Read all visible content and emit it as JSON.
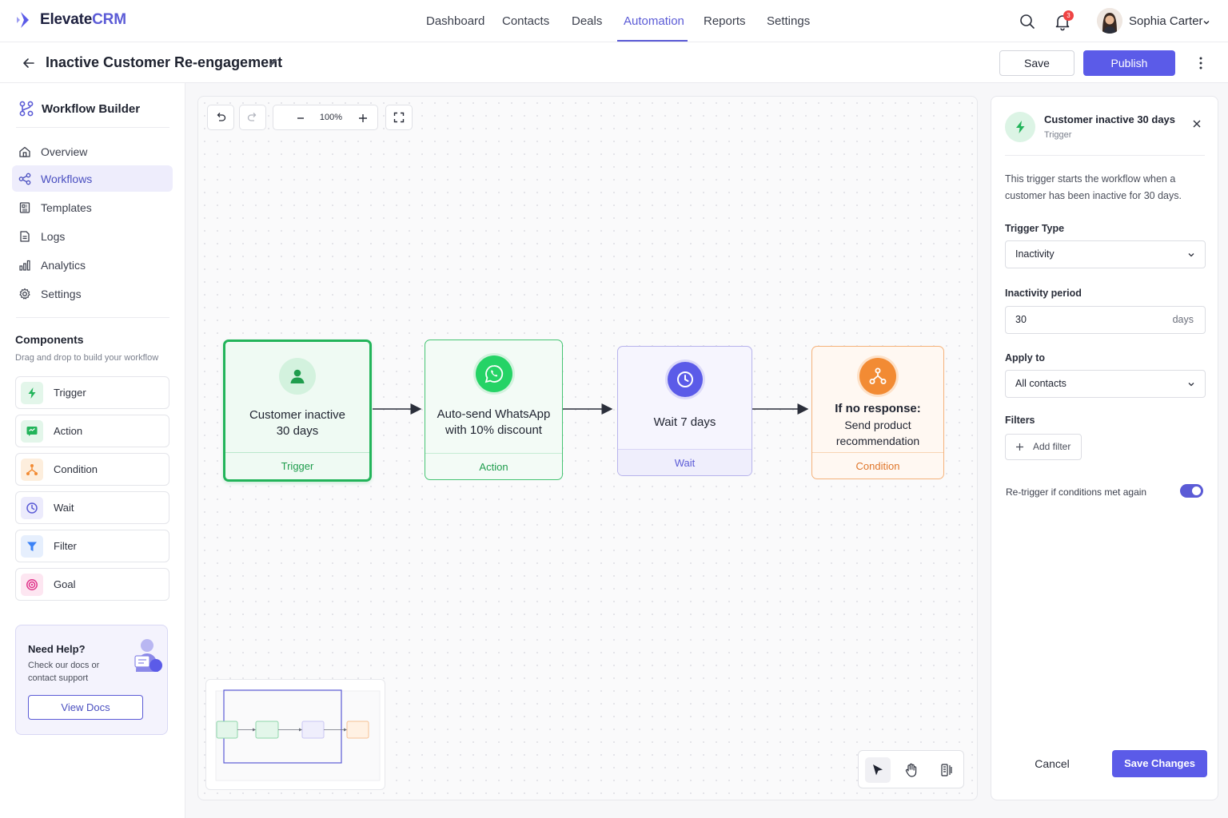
{
  "app": {
    "brand_main": "Elevate",
    "brand_accent": "CRM",
    "accent_color": "#5b5be8"
  },
  "nav": {
    "items": [
      {
        "label": "Dashboard",
        "active": false
      },
      {
        "label": "Contacts",
        "active": false
      },
      {
        "label": "Deals",
        "active": false
      },
      {
        "label": "Automation",
        "active": true
      },
      {
        "label": "Reports",
        "active": false
      },
      {
        "label": "Settings",
        "active": false
      }
    ],
    "notification_count": "3",
    "user_name": "Sophia Carter"
  },
  "header": {
    "title": "Inactive Customer Re-engagement",
    "save_label": "Save",
    "publish_label": "Publish"
  },
  "sidebar": {
    "title": "Workflow Builder",
    "items": [
      {
        "label": "Overview",
        "icon": "home-icon"
      },
      {
        "label": "Workflows",
        "icon": "workflow-icon",
        "active": true
      },
      {
        "label": "Templates",
        "icon": "template-icon"
      },
      {
        "label": "Logs",
        "icon": "log-icon"
      },
      {
        "label": "Analytics",
        "icon": "bar-chart-icon"
      },
      {
        "label": "Settings",
        "icon": "gear-icon"
      }
    ],
    "components_title": "Components",
    "components_subtitle": "Drag and drop to build your workflow",
    "components": [
      {
        "label": "Trigger",
        "icon": "bolt-icon",
        "color": "#22b45a"
      },
      {
        "label": "Action",
        "icon": "message-icon",
        "color": "#22b45a"
      },
      {
        "label": "Condition",
        "icon": "branch-icon",
        "color": "#f28b34"
      },
      {
        "label": "Wait",
        "icon": "clock-icon",
        "color": "#5b5bd6"
      },
      {
        "label": "Filter",
        "icon": "filter-icon",
        "color": "#3b82f6"
      },
      {
        "label": "Goal",
        "icon": "target-icon",
        "color": "#e0338a"
      }
    ],
    "help": {
      "title": "Need Help?",
      "text": "Check our docs or contact support",
      "button": "View Docs"
    }
  },
  "canvas": {
    "zoom": "100%",
    "nodes": [
      {
        "title": "Customer inactive 30 days",
        "type_label": "Trigger",
        "icon": "user-icon"
      },
      {
        "title": "Auto-send WhatsApp with 10% discount",
        "type_label": "Action",
        "icon": "whatsapp-icon"
      },
      {
        "title": "Wait 7 days",
        "type_label": "Wait",
        "icon": "clock-icon"
      },
      {
        "title_bold": "If no response:",
        "title": "Send product recommendation",
        "type_label": "Condition",
        "icon": "branch-icon"
      }
    ]
  },
  "panel": {
    "title": "Customer inactive 30 days",
    "subtitle": "Trigger",
    "description": "This trigger starts the workflow when a customer has been inactive for 30 days.",
    "trigger_type_label": "Trigger Type",
    "trigger_type_value": "Inactivity",
    "inactivity_label": "Inactivity period",
    "inactivity_value": "30",
    "inactivity_unit": "days",
    "apply_label": "Apply to",
    "apply_value": "All contacts",
    "filters_label": "Filters",
    "add_filter_label": "Add filter",
    "retrigger_label": "Re-trigger if conditions met again",
    "retrigger_on": true,
    "cancel_label": "Cancel",
    "save_changes_label": "Save Changes"
  }
}
